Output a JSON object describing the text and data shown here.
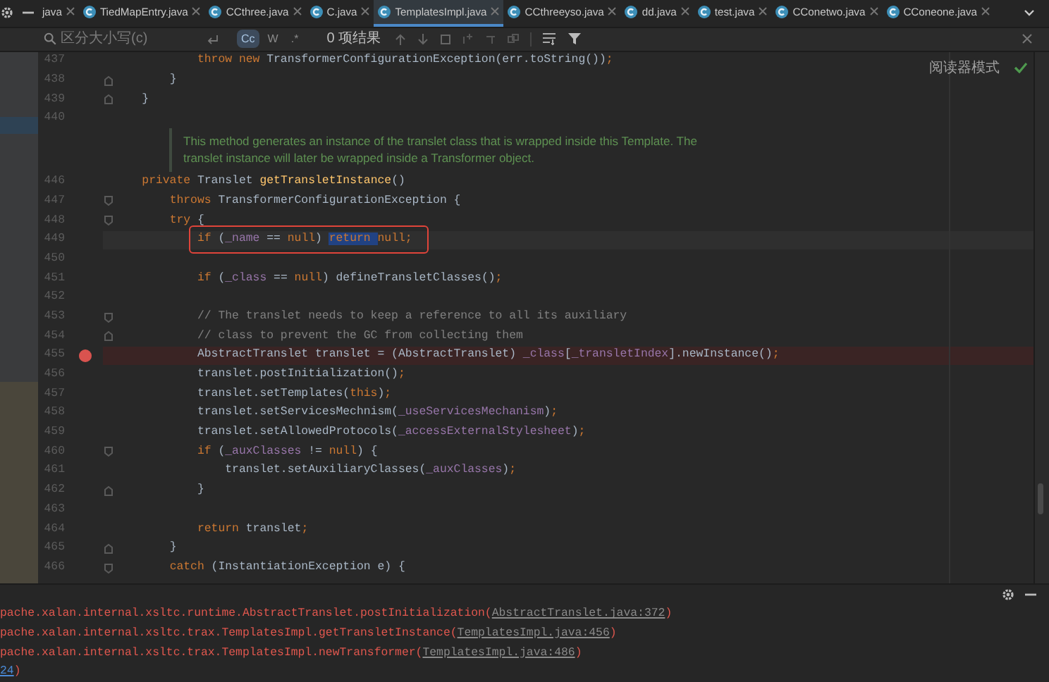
{
  "tabs": [
    {
      "label": "java",
      "selected": false,
      "kind": "clipped"
    },
    {
      "label": "TiedMapEntry.java",
      "selected": false,
      "kind": "class"
    },
    {
      "label": "CCthree.java",
      "selected": false,
      "kind": "class"
    },
    {
      "label": "C.java",
      "selected": false,
      "kind": "class"
    },
    {
      "label": "TemplatesImpl.java",
      "selected": true,
      "kind": "class"
    },
    {
      "label": "CCthreeyso.java",
      "selected": false,
      "kind": "class"
    },
    {
      "label": "dd.java",
      "selected": false,
      "kind": "class"
    },
    {
      "label": "test.java",
      "selected": false,
      "kind": "class"
    },
    {
      "label": "CConetwo.java",
      "selected": false,
      "kind": "class"
    },
    {
      "label": "CConeone.java",
      "selected": false,
      "kind": "class"
    }
  ],
  "search": {
    "placeholder": "区分大小写(c)",
    "toggles": [
      {
        "label": "Cc",
        "on": true
      },
      {
        "label": "W",
        "on": false
      },
      {
        "label": ".*",
        "on": false
      }
    ],
    "result": "0 项结果"
  },
  "reader_mode": {
    "label": "阅读器模式"
  },
  "lines": [
    {
      "kind": "code",
      "number": "437",
      "breakpoint": false,
      "current": false,
      "annotated": false,
      "segments": [
        {
          "text": "            throw new ",
          "kind": "keyword"
        },
        {
          "text": "TransformerConfigurationException(err.toString())",
          "kind": "plain"
        },
        {
          "text": ";",
          "kind": "keyword"
        }
      ]
    },
    {
      "kind": "fold_end",
      "number": "438",
      "breakpoint": false,
      "current": false,
      "annotated": false,
      "segments": [
        {
          "text": "        }",
          "kind": "plain"
        }
      ]
    },
    {
      "kind": "fold_end",
      "number": "439",
      "breakpoint": false,
      "current": false,
      "annotated": false,
      "segments": [
        {
          "text": "    }",
          "kind": "plain"
        }
      ]
    },
    {
      "kind": "code",
      "number": "440",
      "breakpoint": false,
      "current": false,
      "annotated": false
    },
    {
      "kind": "doc",
      "text": [
        "This method generates an instance of the translet class that is wrapped inside this Template. The",
        "translet instance will later be wrapped inside a Transformer object."
      ]
    },
    {
      "kind": "code",
      "number": "446",
      "breakpoint": false,
      "current": false,
      "annotated": false,
      "segments": [
        {
          "text": "    private ",
          "kind": "keyword"
        },
        {
          "text": "Translet ",
          "kind": "plain"
        },
        {
          "text": "getTransletInstance",
          "kind": "method"
        },
        {
          "text": "()",
          "kind": "plain"
        }
      ]
    },
    {
      "kind": "fold_start",
      "number": "447",
      "breakpoint": false,
      "current": false,
      "annotated": false,
      "segments": [
        {
          "text": "        throws ",
          "kind": "keyword"
        },
        {
          "text": "TransformerConfigurationException {",
          "kind": "plain"
        }
      ]
    },
    {
      "kind": "fold_start",
      "number": "448",
      "breakpoint": false,
      "current": false,
      "annotated": false,
      "segments": [
        {
          "text": "        try ",
          "kind": "keyword"
        },
        {
          "text": "{",
          "kind": "plain"
        }
      ]
    },
    {
      "kind": "code",
      "number": "449",
      "breakpoint": false,
      "current": true,
      "annotated": true,
      "segments": [
        {
          "text": "            if ",
          "kind": "keyword"
        },
        {
          "text": "(",
          "kind": "plain"
        },
        {
          "text": "_name",
          "kind": "field"
        },
        {
          "text": " == ",
          "kind": "plain"
        },
        {
          "text": "null",
          "kind": "keyword"
        },
        {
          "text": ") ",
          "kind": "plain"
        },
        {
          "text": "return ",
          "kind": "keyword",
          "selected": true
        },
        {
          "text": "null",
          "kind": "keyword"
        },
        {
          "text": ";",
          "kind": "keyword"
        }
      ]
    },
    {
      "kind": "code",
      "number": "450",
      "breakpoint": false,
      "current": false,
      "annotated": false
    },
    {
      "kind": "code",
      "number": "451",
      "breakpoint": false,
      "current": false,
      "annotated": false,
      "segments": [
        {
          "text": "            if ",
          "kind": "keyword"
        },
        {
          "text": "(",
          "kind": "plain"
        },
        {
          "text": "_class",
          "kind": "field"
        },
        {
          "text": " == ",
          "kind": "plain"
        },
        {
          "text": "null",
          "kind": "keyword"
        },
        {
          "text": ") defineTransletClasses()",
          "kind": "plain"
        },
        {
          "text": ";",
          "kind": "keyword"
        }
      ]
    },
    {
      "kind": "code",
      "number": "452",
      "breakpoint": false,
      "current": false,
      "annotated": false
    },
    {
      "kind": "fold_start",
      "number": "453",
      "breakpoint": false,
      "current": false,
      "annotated": false,
      "segments": [
        {
          "text": "            // The translet needs to keep a reference to all its auxiliary",
          "kind": "comment"
        }
      ]
    },
    {
      "kind": "fold_end",
      "number": "454",
      "breakpoint": false,
      "current": false,
      "annotated": false,
      "segments": [
        {
          "text": "            // class to prevent the GC from collecting them",
          "kind": "comment"
        }
      ]
    },
    {
      "kind": "code",
      "number": "455",
      "breakpoint": true,
      "current": false,
      "annotated": false,
      "segments": [
        {
          "text": "            AbstractTranslet translet = (AbstractTranslet) ",
          "kind": "plain"
        },
        {
          "text": "_class",
          "kind": "field"
        },
        {
          "text": "[",
          "kind": "plain"
        },
        {
          "text": "_transletIndex",
          "kind": "field"
        },
        {
          "text": "].newInstance()",
          "kind": "plain"
        },
        {
          "text": ";",
          "kind": "keyword"
        }
      ]
    },
    {
      "kind": "code",
      "number": "456",
      "breakpoint": false,
      "current": false,
      "annotated": false,
      "segments": [
        {
          "text": "            translet.postInitialization()",
          "kind": "plain"
        },
        {
          "text": ";",
          "kind": "keyword"
        }
      ]
    },
    {
      "kind": "code",
      "number": "457",
      "breakpoint": false,
      "current": false,
      "annotated": false,
      "segments": [
        {
          "text": "            translet.setTemplates(",
          "kind": "plain"
        },
        {
          "text": "this",
          "kind": "keyword"
        },
        {
          "text": ")",
          "kind": "plain"
        },
        {
          "text": ";",
          "kind": "keyword"
        }
      ]
    },
    {
      "kind": "code",
      "number": "458",
      "breakpoint": false,
      "current": false,
      "annotated": false,
      "segments": [
        {
          "text": "            translet.setServicesMechnism(",
          "kind": "plain"
        },
        {
          "text": "_useServicesMechanism",
          "kind": "field"
        },
        {
          "text": ")",
          "kind": "plain"
        },
        {
          "text": ";",
          "kind": "keyword"
        }
      ]
    },
    {
      "kind": "code",
      "number": "459",
      "breakpoint": false,
      "current": false,
      "annotated": false,
      "segments": [
        {
          "text": "            translet.setAllowedProtocols(",
          "kind": "plain"
        },
        {
          "text": "_accessExternalStylesheet",
          "kind": "field"
        },
        {
          "text": ")",
          "kind": "plain"
        },
        {
          "text": ";",
          "kind": "keyword"
        }
      ]
    },
    {
      "kind": "fold_start",
      "number": "460",
      "breakpoint": false,
      "current": false,
      "annotated": false,
      "segments": [
        {
          "text": "            if ",
          "kind": "keyword"
        },
        {
          "text": "(",
          "kind": "plain"
        },
        {
          "text": "_auxClasses",
          "kind": "field"
        },
        {
          "text": " != ",
          "kind": "plain"
        },
        {
          "text": "null",
          "kind": "keyword"
        },
        {
          "text": ") {",
          "kind": "plain"
        }
      ]
    },
    {
      "kind": "code",
      "number": "461",
      "breakpoint": false,
      "current": false,
      "annotated": false,
      "segments": [
        {
          "text": "                translet.setAuxiliaryClasses(",
          "kind": "plain"
        },
        {
          "text": "_auxClasses",
          "kind": "field"
        },
        {
          "text": ")",
          "kind": "plain"
        },
        {
          "text": ";",
          "kind": "keyword"
        }
      ]
    },
    {
      "kind": "fold_end",
      "number": "462",
      "breakpoint": false,
      "current": false,
      "annotated": false,
      "segments": [
        {
          "text": "            }",
          "kind": "plain"
        }
      ]
    },
    {
      "kind": "code",
      "number": "463",
      "breakpoint": false,
      "current": false,
      "annotated": false
    },
    {
      "kind": "code",
      "number": "464",
      "breakpoint": false,
      "current": false,
      "annotated": false,
      "segments": [
        {
          "text": "            return ",
          "kind": "keyword"
        },
        {
          "text": "translet",
          "kind": "plain"
        },
        {
          "text": ";",
          "kind": "keyword"
        }
      ]
    },
    {
      "kind": "fold_end",
      "number": "465",
      "breakpoint": false,
      "current": false,
      "annotated": false,
      "segments": [
        {
          "text": "        }",
          "kind": "plain"
        }
      ]
    },
    {
      "kind": "fold_start",
      "number": "466",
      "breakpoint": false,
      "current": false,
      "annotated": false,
      "segments": [
        {
          "text": "        catch ",
          "kind": "keyword"
        },
        {
          "text": "(InstantiationException e) {",
          "kind": "plain"
        }
      ]
    }
  ],
  "console": [
    [
      {
        "text": "pache.xalan.internal.xsltc.runtime.AbstractTranslet.postInitialization(",
        "kind": "error"
      },
      {
        "text": "AbstractTranslet.java:372",
        "kind": "link"
      },
      {
        "text": ")",
        "kind": "error"
      }
    ],
    [
      {
        "text": "pache.xalan.internal.xsltc.trax.TemplatesImpl.getTransletInstance(",
        "kind": "error"
      },
      {
        "text": "TemplatesImpl.java:456",
        "kind": "link"
      },
      {
        "text": ")",
        "kind": "error"
      }
    ],
    [
      {
        "text": "pache.xalan.internal.xsltc.trax.TemplatesImpl.newTransformer(",
        "kind": "error"
      },
      {
        "text": "TemplatesImpl.java:486",
        "kind": "link"
      },
      {
        "text": ")",
        "kind": "error"
      }
    ],
    [
      {
        "text": "24",
        "kind": "user_link"
      },
      {
        "text": ")",
        "kind": "error"
      }
    ]
  ]
}
